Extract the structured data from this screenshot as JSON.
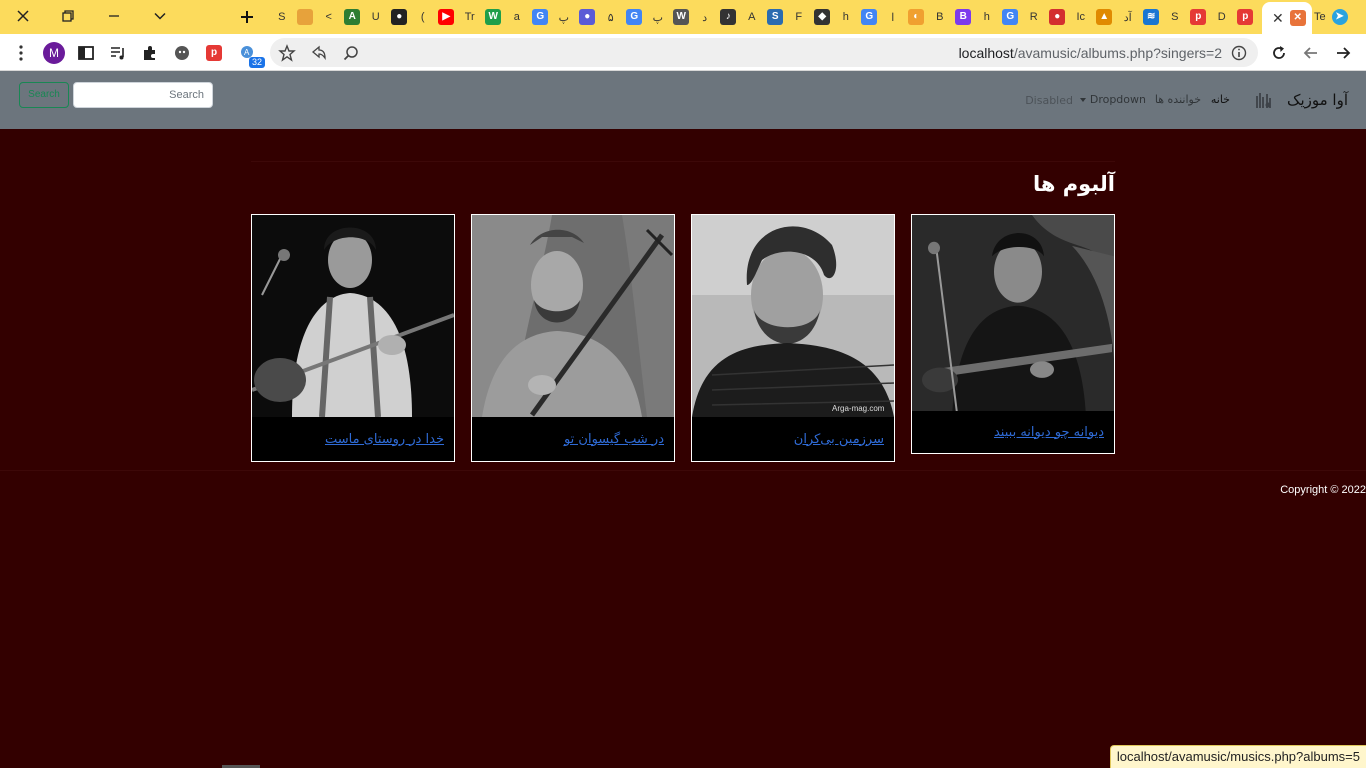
{
  "browser": {
    "address_bar": {
      "url_host": "localhost",
      "url_path": "/avamusic/albums.php?singers=2"
    },
    "profile_initial": "M",
    "extension_badge": "32",
    "tabs": [
      {
        "kind": "letter",
        "text": "S"
      },
      {
        "kind": "icon",
        "text": "",
        "color": "#e7a23b"
      },
      {
        "kind": "letter",
        "text": "<"
      },
      {
        "kind": "icon",
        "text": "A",
        "color": "#2e7d32"
      },
      {
        "kind": "letter",
        "text": "U"
      },
      {
        "kind": "icon",
        "text": "●",
        "color": "#222222"
      },
      {
        "kind": "letter",
        "text": "("
      },
      {
        "kind": "icon",
        "text": "▶",
        "color": "#ff0000"
      },
      {
        "kind": "letter",
        "text": "Tr"
      },
      {
        "kind": "icon",
        "text": "W",
        "color": "#1e9e4a"
      },
      {
        "kind": "letter",
        "text": "a"
      },
      {
        "kind": "icon",
        "text": "G",
        "color": "#4285f4"
      },
      {
        "kind": "letter",
        "text": "پ"
      },
      {
        "kind": "icon",
        "text": "●",
        "color": "#5b5bd6"
      },
      {
        "kind": "letter",
        "text": "۵"
      },
      {
        "kind": "icon",
        "text": "G",
        "color": "#4285f4"
      },
      {
        "kind": "letter",
        "text": "پ"
      },
      {
        "kind": "icon",
        "text": "W",
        "color": "#555555"
      },
      {
        "kind": "letter",
        "text": "د"
      },
      {
        "kind": "icon",
        "text": "♪",
        "color": "#333333"
      },
      {
        "kind": "letter",
        "text": "A"
      },
      {
        "kind": "icon",
        "text": "S",
        "color": "#2b6cb0"
      },
      {
        "kind": "letter",
        "text": "F"
      },
      {
        "kind": "icon",
        "text": "◆",
        "color": "#333333"
      },
      {
        "kind": "letter",
        "text": "h"
      },
      {
        "kind": "icon",
        "text": "G",
        "color": "#4285f4"
      },
      {
        "kind": "letter",
        "text": "ا"
      },
      {
        "kind": "icon",
        "text": "◐",
        "color": "#f0a030"
      },
      {
        "kind": "letter",
        "text": "B"
      },
      {
        "kind": "icon",
        "text": "B",
        "color": "#7c3aed"
      },
      {
        "kind": "letter",
        "text": "h"
      },
      {
        "kind": "icon",
        "text": "G",
        "color": "#4285f4"
      },
      {
        "kind": "letter",
        "text": "R"
      },
      {
        "kind": "icon",
        "text": "●",
        "color": "#d32f2f"
      },
      {
        "kind": "letter",
        "text": "Ic"
      },
      {
        "kind": "icon",
        "text": "▲",
        "color": "#e08a00"
      },
      {
        "kind": "letter",
        "text": "آد"
      },
      {
        "kind": "icon",
        "text": "≋",
        "color": "#1976d2"
      },
      {
        "kind": "letter",
        "text": "S"
      },
      {
        "kind": "icon",
        "text": "p",
        "color": "#e53935"
      },
      {
        "kind": "letter",
        "text": "D"
      },
      {
        "kind": "icon",
        "text": "p",
        "color": "#e53935"
      }
    ],
    "active_tab": {
      "icon_color": "#e8733a"
    },
    "trailing_tab": {
      "text": "Te"
    },
    "status_url": "localhost/avamusic/musics.php?albums=5"
  },
  "site": {
    "brand": "آوا موزیک",
    "nav": {
      "home": "خانه",
      "singers": "خواننده ها",
      "dropdown": "Dropdown",
      "disabled": "Disabled"
    },
    "search": {
      "placeholder": "Search",
      "button": "Search"
    },
    "page_title": "آلبوم ها",
    "albums": [
      {
        "title": "دیوانه چو دیوانه ببیند"
      },
      {
        "title": "سرزمین بی‌کران",
        "watermark": "Arga-mag.com"
      },
      {
        "title": "در شب گیسوان تو"
      },
      {
        "title": "خدا در روستای ماست"
      }
    ],
    "copyright": "Copyright © 2022"
  },
  "colors": {
    "tabstrip": "#fcdb5c",
    "navbar": "#6c757d",
    "page_bg": "#330000",
    "link": "#2f6bd6",
    "search_green": "#198754"
  }
}
